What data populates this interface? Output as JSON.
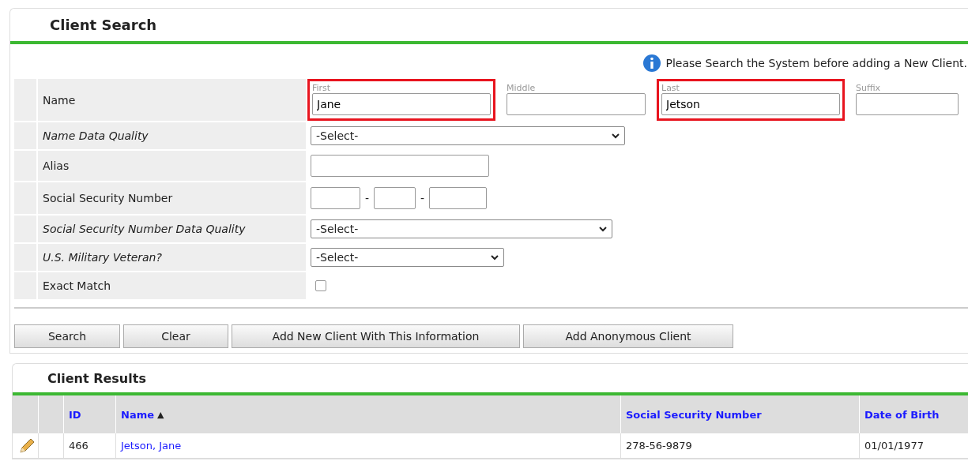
{
  "search_panel": {
    "title": "Client Search",
    "notice": "Please Search the System before adding a New Client.",
    "rows": [
      {
        "kind": "name",
        "label": "Name",
        "italic": false,
        "parts": [
          {
            "label": "First",
            "value": "Jane",
            "highlighted": true
          },
          {
            "label": "Middle",
            "highlighted": false
          },
          {
            "label": "Last",
            "value": "Jetson",
            "highlighted": true
          },
          {
            "label": "Suffix",
            "highlighted": false
          }
        ]
      },
      {
        "kind": "select",
        "label": "Name Data Quality",
        "italic": true,
        "value": "-Select-"
      },
      {
        "kind": "text",
        "label": "Alias",
        "italic": false
      },
      {
        "kind": "ssn",
        "label": "Social Security Number",
        "italic": false,
        "separators": [
          "-",
          "-"
        ]
      },
      {
        "kind": "select",
        "label": "Social Security Number Data Quality",
        "italic": true,
        "value": "-Select-"
      },
      {
        "kind": "select",
        "label": "U.S. Military Veteran?",
        "italic": true,
        "value": "-Select-"
      },
      {
        "kind": "checkbox",
        "label": "Exact Match",
        "italic": false,
        "checked": false
      }
    ],
    "buttons": [
      "Search",
      "Clear",
      "Add New Client With This Information",
      "Add Anonymous Client"
    ]
  },
  "results_panel": {
    "title": "Client Results",
    "columns": [
      {
        "label": "ID"
      },
      {
        "label": "Name",
        "sort": "▲"
      },
      {
        "label": "Social Security Number"
      },
      {
        "label": "Date of Birth"
      }
    ],
    "rows": [
      {
        "id": "466",
        "name": "Jetson, Jane",
        "ssn": "278-56-9879",
        "dob": "01/01/1977"
      }
    ]
  }
}
